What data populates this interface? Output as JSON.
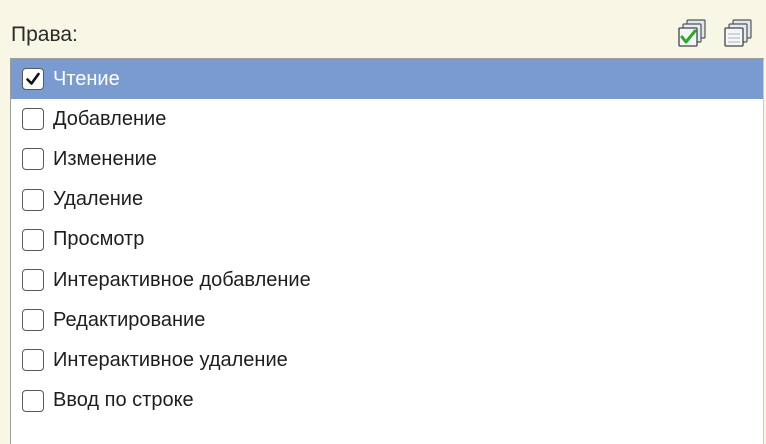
{
  "header": {
    "title": "Права:",
    "check_all_icon": "check-all-icon",
    "uncheck_all_icon": "uncheck-all-icon"
  },
  "colors": {
    "background": "#f8f6e4",
    "selection": "#799bd0",
    "check_green": "#2ea62a"
  },
  "rights": {
    "items": [
      {
        "label": "Чтение",
        "checked": true,
        "selected": true
      },
      {
        "label": "Добавление",
        "checked": false,
        "selected": false
      },
      {
        "label": "Изменение",
        "checked": false,
        "selected": false
      },
      {
        "label": "Удаление",
        "checked": false,
        "selected": false
      },
      {
        "label": "Просмотр",
        "checked": false,
        "selected": false
      },
      {
        "label": "Интерактивное добавление",
        "checked": false,
        "selected": false
      },
      {
        "label": "Редактирование",
        "checked": false,
        "selected": false
      },
      {
        "label": "Интерактивное удаление",
        "checked": false,
        "selected": false
      },
      {
        "label": "Ввод по строке",
        "checked": false,
        "selected": false
      }
    ]
  }
}
